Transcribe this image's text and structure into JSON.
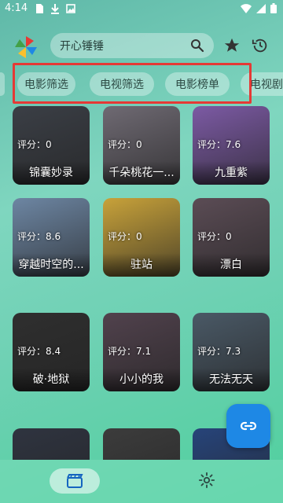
{
  "status_bar": {
    "time": "4:14",
    "left_icons": [
      "sim-card-icon",
      "download-icon",
      "image-icon"
    ],
    "right_icons": [
      "wifi-icon",
      "signal-icon",
      "battery-icon"
    ]
  },
  "top_bar": {
    "logo_icon": "pinwheel-logo-icon",
    "search_text": "开心锤锤",
    "search_icon": "search-icon",
    "favorite_icon": "star-icon",
    "history_icon": "history-icon"
  },
  "tabs": [
    "电影筛选",
    "电视筛选",
    "电影榜单",
    "电视剧"
  ],
  "movies": [
    {
      "title": "锦囊妙录",
      "score_label": "评分：",
      "score": "0",
      "color": "#3b3f46"
    },
    {
      "title": "千朵桃花一...",
      "score_label": "评分：",
      "score": "0",
      "color": "#6f6a73"
    },
    {
      "title": "九重紫",
      "score_label": "评分：",
      "score": "7.6",
      "color": "#7c5aa4"
    },
    {
      "title": "穿越时空的...",
      "score_label": "评分：",
      "score": "8.6",
      "color": "#6d86a3"
    },
    {
      "title": "驻站",
      "score_label": "评分：",
      "score": "0",
      "color": "#c8a23a"
    },
    {
      "title": "漂白",
      "score_label": "评分：",
      "score": "0",
      "color": "#5b4c55"
    },
    {
      "title": "破·地狱",
      "score_label": "评分：",
      "score": "8.4",
      "color": "#2f2f2f"
    },
    {
      "title": "小小的我",
      "score_label": "评分：",
      "score": "7.1",
      "color": "#51424d"
    },
    {
      "title": "无法无天",
      "score_label": "评分：",
      "score": "7.3",
      "color": "#4a5966"
    },
    {
      "title": "",
      "score_label": "",
      "score": "",
      "color": "#2f3440"
    },
    {
      "title": "",
      "score_label": "",
      "score": "",
      "color": "#3c3c3c"
    },
    {
      "title": "",
      "score_label": "",
      "score": "",
      "color": "#27447a"
    }
  ],
  "fab_icon": "link-icon",
  "bottom_nav": {
    "movies_icon": "clapperboard-icon",
    "settings_icon": "gear-icon"
  },
  "colors": {
    "highlight": "#e53935",
    "fab": "#1e88e5"
  }
}
